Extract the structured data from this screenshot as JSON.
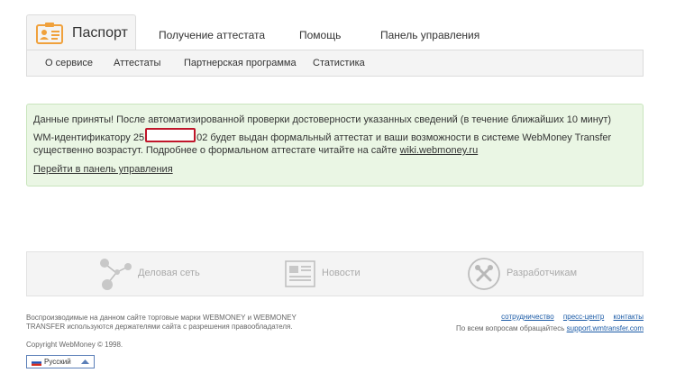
{
  "nav": {
    "active_tab": "Паспорт",
    "tabs": [
      "Получение аттестата",
      "Помощь",
      "Панель управления"
    ],
    "subnav": [
      "О сервисе",
      "Аттестаты",
      "Партнерская программа",
      "Статистика"
    ]
  },
  "message": {
    "line1": "Данные приняты! После автоматизированной проверки достоверности указанных сведений (в течение ближайших 10 минут)",
    "line2_prefix": "WM-идентификатору 25",
    "line2_suffix": "02 будет выдан формальный аттестат и ваши возможности в системе WebMoney Transfer",
    "line3_text": "существенно возрастут. Подробнее о формальном аттестате читайте на сайте ",
    "line3_link": "wiki.webmoney.ru",
    "control_link": "Перейти в панель управления"
  },
  "services": {
    "items": [
      {
        "label": "Деловая сеть",
        "icon": "business-network-icon"
      },
      {
        "label": "Новости",
        "icon": "newspaper-icon"
      },
      {
        "label": "Разработчикам",
        "icon": "tools-icon"
      }
    ]
  },
  "footer": {
    "legal": "Воспроизводимые на данном сайте торговые марки WEBMONEY и WEBMONEY TRANSFER используются держателями сайта с разрешения правообладателя.",
    "copyright": "Copyright WebMoney © 1998.",
    "links": [
      "сотрудничество",
      "пресс-центр",
      "контакты"
    ],
    "support_text": "По всем вопросам обращайтесь ",
    "support_link": "support.wmtransfer.com",
    "language": "Русский"
  },
  "colors": {
    "message_bg": "#eaf6e4",
    "message_border": "#c9e5bd",
    "link_blue": "#1a5aa6",
    "passport_orange": "#f0a13c"
  }
}
